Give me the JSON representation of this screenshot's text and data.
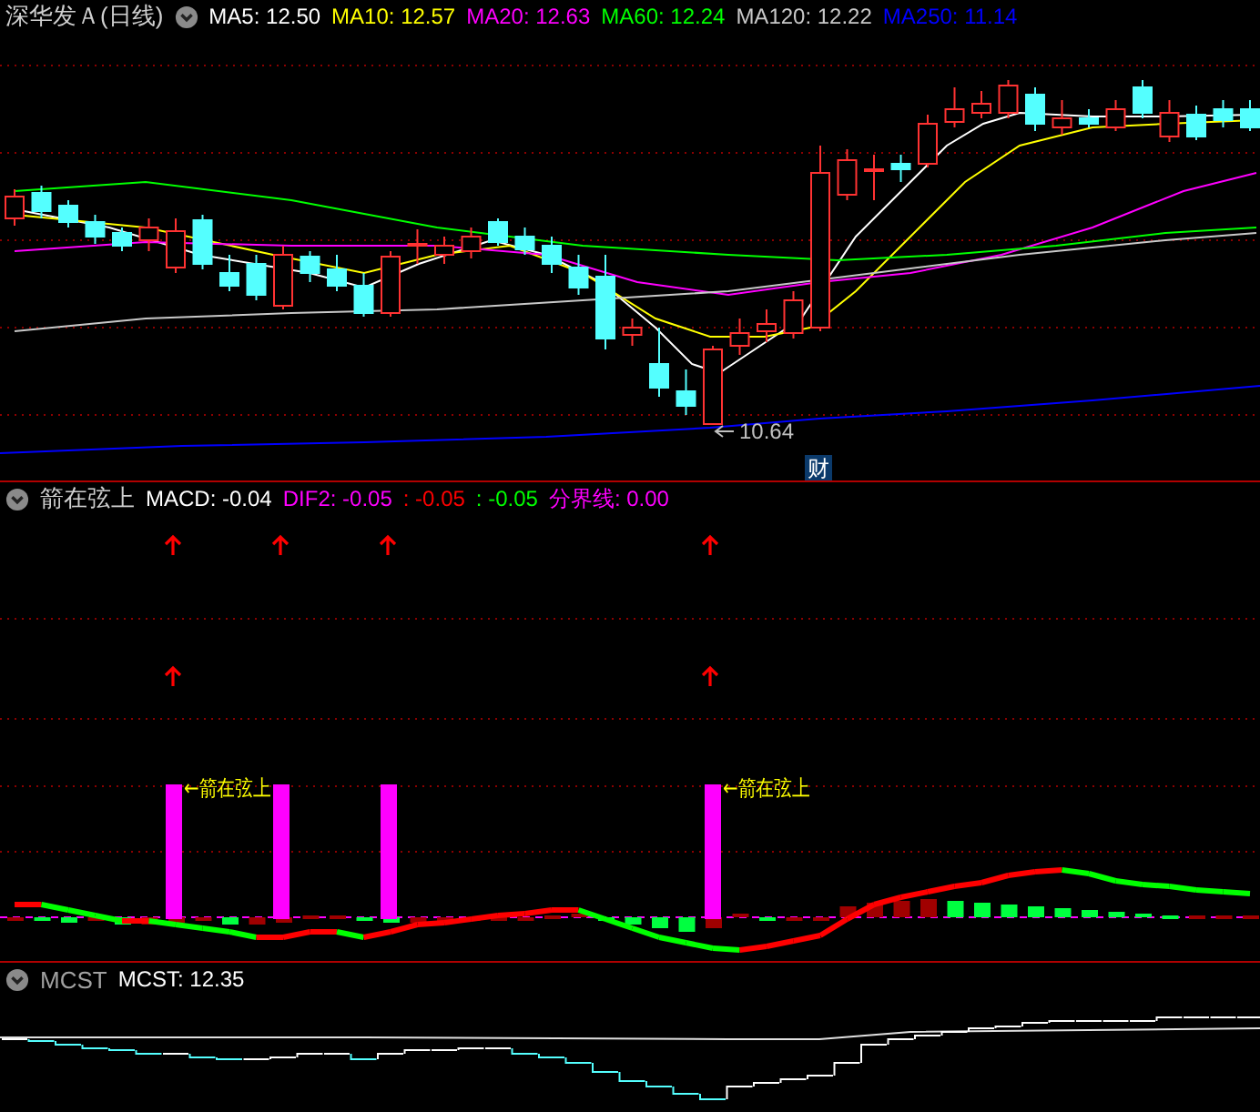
{
  "main_chart": {
    "title": "深华发Ａ(日线)",
    "indicators": [
      {
        "label": "MA5: 12.50",
        "color": "#ffffff"
      },
      {
        "label": "MA10: 12.57",
        "color": "#ffff00"
      },
      {
        "label": "MA20: 12.63",
        "color": "#ff00ff"
      },
      {
        "label": "MA60: 12.24",
        "color": "#00ff00"
      },
      {
        "label": "MA120: 12.22",
        "color": "#c8c8c8"
      },
      {
        "label": "MA250: 11.14",
        "color": "#0000ff"
      }
    ],
    "low_label": "10.64",
    "badge": "财"
  },
  "indicator_panel": {
    "title": "箭在弦上",
    "values": [
      {
        "label": "MACD: -0.04",
        "color": "#ffffff"
      },
      {
        "label": "DIF2: -0.05",
        "color": "#ff00ff"
      },
      {
        "label": ": -0.05",
        "color": "#ff0000"
      },
      {
        "label": ": -0.05",
        "color": "#00ff00"
      },
      {
        "label": "分界线: 0.00",
        "color": "#ff00ff"
      }
    ],
    "signal_labels": [
      "←箭在弦上",
      "←箭在弦上"
    ]
  },
  "mcst_panel": {
    "title": "MCST",
    "values": [
      {
        "label": "MCST: 12.35",
        "color": "#ffffff"
      }
    ]
  }
}
